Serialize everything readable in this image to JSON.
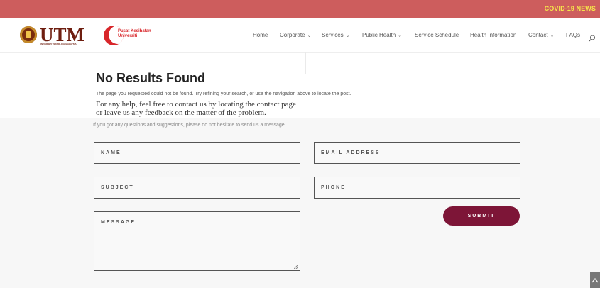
{
  "topbar": {
    "covid_link": "COVID-19 NEWS"
  },
  "brand": {
    "logo_text": "UTM",
    "logo_subtext": "UNIVERSITI TEKNOLOGI MALAYSIA",
    "pk_line1": "Pusat Kesihatan",
    "pk_line2": "Universiti"
  },
  "nav": {
    "items": [
      {
        "label": "Home",
        "dropdown": false
      },
      {
        "label": "Corporate",
        "dropdown": true
      },
      {
        "label": "Services",
        "dropdown": true
      },
      {
        "label": "Public Health",
        "dropdown": true
      },
      {
        "label": "Service Schedule",
        "dropdown": false
      },
      {
        "label": "Health Information",
        "dropdown": false
      },
      {
        "label": "Contact",
        "dropdown": true
      },
      {
        "label": "FAQs",
        "dropdown": false
      }
    ],
    "search_icon": "search-icon"
  },
  "page": {
    "title": "No Results Found",
    "description": "The page you requested could not be found. Try refining your search, or use the navigation above to locate the post.",
    "help_line1": "For any help, feel free to contact us by locating the contact page",
    "help_line2": "or leave us any feedback on the matter of the problem."
  },
  "contact_form": {
    "intro": "If you got any questions and suggestions, please do not hesitate to send us a message.",
    "name_placeholder": "NAME",
    "email_placeholder": "EMAIL ADDRESS",
    "subject_placeholder": "SUBJECT",
    "phone_placeholder": "PHONE",
    "message_placeholder": "MESSAGE",
    "submit_label": "SUBMIT"
  },
  "colors": {
    "topbar": "#cd5d5d",
    "covid_link": "#f5e34b",
    "submit": "#7d1537",
    "section_bg": "#f7f7f7"
  }
}
